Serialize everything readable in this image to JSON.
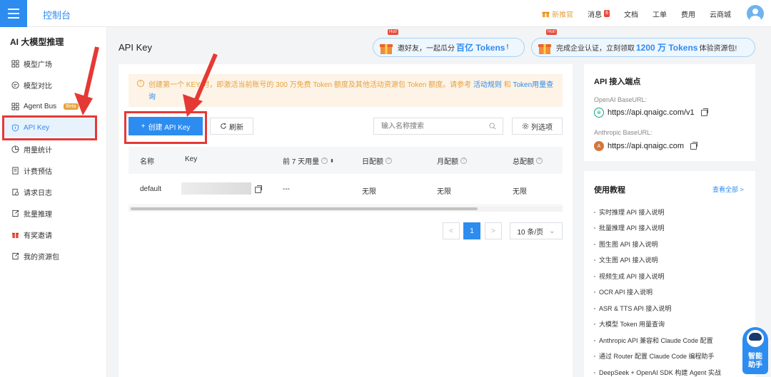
{
  "header": {
    "title": "控制台",
    "nav": {
      "promo": "新推官",
      "messages": "消息",
      "messages_badge": "6",
      "docs": "文档",
      "tickets": "工单",
      "billing": "费用",
      "marketplace": "云商城"
    }
  },
  "sidebar": {
    "title": "AI 大模型推理",
    "items": [
      {
        "label": "模型广场"
      },
      {
        "label": "模型对比"
      },
      {
        "label": "Agent Bus",
        "badge": "Beta"
      },
      {
        "label": "API Key"
      },
      {
        "label": "用量统计"
      },
      {
        "label": "计费预估"
      },
      {
        "label": "请求日志"
      },
      {
        "label": "批量推理"
      },
      {
        "label": "有奖邀请"
      },
      {
        "label": "我的资源包"
      }
    ]
  },
  "page": {
    "title": "API Key",
    "promo1": {
      "hot": "Hot!",
      "before": "邀好友，一起瓜分",
      "highlight": "百亿 Tokens",
      "after": "!"
    },
    "promo2": {
      "hot": "Hot!",
      "before": "完成企业认证，立刻领取",
      "highlight": "1200 万 Tokens",
      "after": "体验资源包!"
    }
  },
  "notice": {
    "text1": "创建第一个 KEY 时，即激活当前账号的 300 万免费 Token 额度及其他活动资源包 Token 额度。请参考",
    "link1": "活动规则",
    "and": "和",
    "link2": "Token用量查询"
  },
  "toolbar": {
    "create_label": "创建 API Key",
    "refresh_label": "刷新",
    "search_placeholder": "输入名称搜索",
    "columns_label": "列选项"
  },
  "table": {
    "headers": [
      "名称",
      "Key",
      "前 7 天用量",
      "日配额",
      "月配额",
      "总配额"
    ],
    "rows": [
      {
        "name": "default",
        "usage": "---",
        "daily": "无限",
        "monthly": "无限",
        "total": "无限"
      }
    ]
  },
  "pagination": {
    "prev": "<",
    "current": "1",
    "next": ">",
    "page_size": "10 条/页"
  },
  "endpoints": {
    "title": "API 接入端点",
    "openai_label": "OpenAI BaseURL:",
    "openai_url": "https://api.qnaigc.com/v1",
    "anthropic_label": "Anthropic BaseURL:",
    "anthropic_url": "https://api.qnaigc.com"
  },
  "tutorials": {
    "title": "使用教程",
    "view_all": "查看全部 >",
    "items": [
      "实时推理 API 接入说明",
      "批量推理 API 接入说明",
      "图生图 API 接入说明",
      "文生图 API 接入说明",
      "视频生成 API 接入说明",
      "OCR API 接入说明",
      "ASR & TTS API 接入说明",
      "大模型 Token 用量查询",
      "Anthropic API 兼容和 Claude Code 配置",
      "通过 Router 配置 Claude Code 编程助手",
      "DeepSeek + OpenAI SDK 构建 Agent 实战"
    ]
  },
  "assistant": {
    "line1": "智能",
    "line2": "助手"
  },
  "colors": {
    "primary": "#2d8cf0",
    "warning": "#e6a23c",
    "highlight": "#e53935"
  }
}
